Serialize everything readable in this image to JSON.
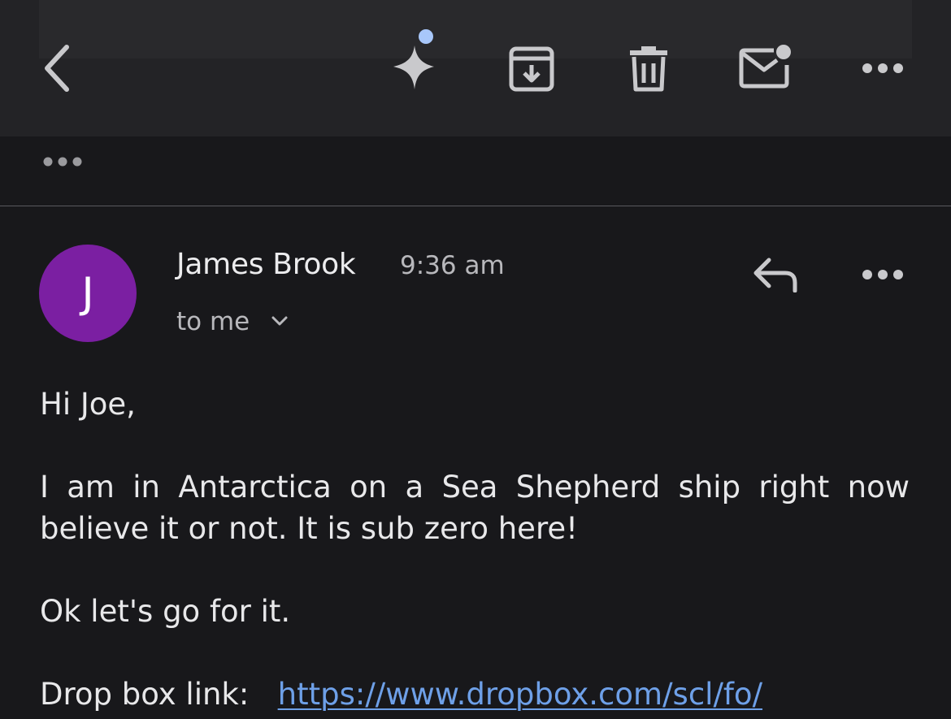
{
  "toolbar": {
    "back": "back",
    "icons": [
      "chevron-left-icon",
      "sparkle-icon",
      "archive-icon",
      "trash-icon",
      "mark-unread-icon",
      "more-horizontal-icon"
    ]
  },
  "thread": {
    "collapsed_indicator": "•••"
  },
  "message": {
    "avatar_initial": "J",
    "avatar_color": "#7b1fa2",
    "sender": "James Brook",
    "time": "9:36 am",
    "recipient": "to me",
    "body": {
      "greeting": "Hi Joe,",
      "paragraph1": "I am in Antarctica on a Sea Shepherd ship right now believe it or not. It is sub zero here!",
      "paragraph2": "Ok let's go for it.",
      "link_label": "Drop box link:",
      "link_url": "https://www.dropbox.com/scl/fo/"
    }
  },
  "colors": {
    "toolbar_bg": "#232326",
    "page_bg": "#18181b",
    "link": "#6ea0e8",
    "sparkle_dot": "#a8c7fa"
  }
}
